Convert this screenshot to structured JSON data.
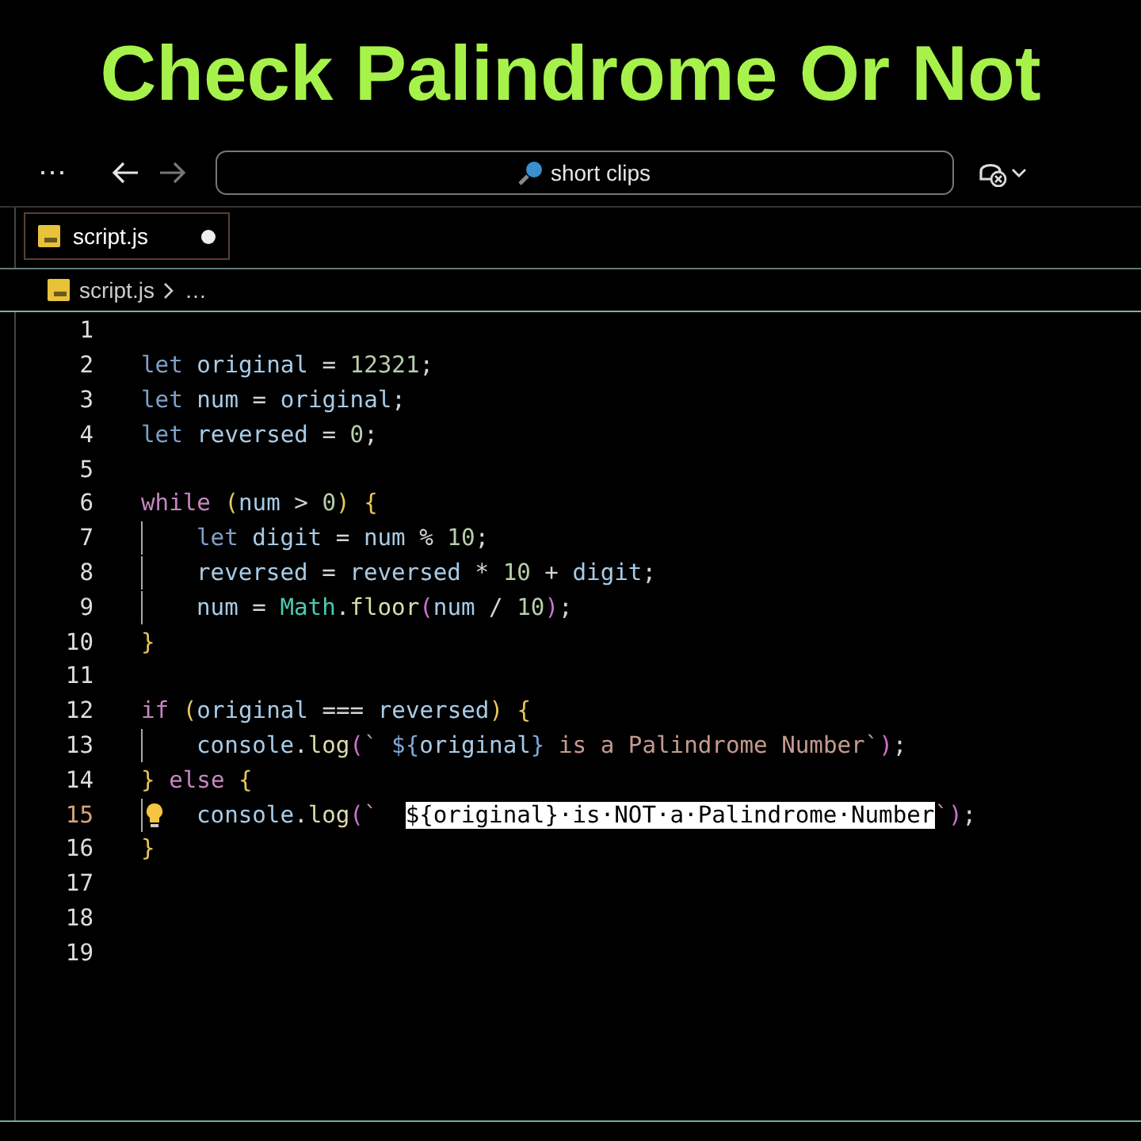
{
  "headline": "Check Palindrome Or Not",
  "toolbar": {
    "more": "⋯",
    "back_enabled": true,
    "forward_enabled": false,
    "search": {
      "value": "short clips"
    }
  },
  "tabs": [
    {
      "label": "script.js",
      "selected": true,
      "modified": true
    }
  ],
  "breadcrumb": [
    "script.js",
    "…"
  ],
  "editor": {
    "lines": [
      {
        "number": "1",
        "current": false
      },
      {
        "number": "2",
        "current": false,
        "tokens": [
          {
            "text": "let",
            "kind": "keyword"
          },
          {
            "text": " original",
            "kind": "variable"
          },
          {
            "text": " = ",
            "kind": "plain"
          },
          {
            "text": "12321",
            "kind": "number"
          },
          {
            "text": ";",
            "kind": "plain"
          }
        ]
      },
      {
        "number": "3",
        "current": false,
        "tokens": [
          {
            "text": "let",
            "kind": "keyword"
          },
          {
            "text": " num",
            "kind": "variable"
          },
          {
            "text": " = ",
            "kind": "plain"
          },
          {
            "text": "original",
            "kind": "variable"
          },
          {
            "text": ";",
            "kind": "plain"
          }
        ]
      },
      {
        "number": "4",
        "current": false,
        "tokens": [
          {
            "text": "let",
            "kind": "keyword"
          },
          {
            "text": " reversed",
            "kind": "variable"
          },
          {
            "text": " = ",
            "kind": "plain"
          },
          {
            "text": "0",
            "kind": "number"
          },
          {
            "text": ";",
            "kind": "plain"
          }
        ]
      },
      {
        "number": "5",
        "current": false
      },
      {
        "number": "6",
        "current": false,
        "tokens": [
          {
            "text": "while",
            "kind": "control"
          },
          {
            "text": " (",
            "kind": "bracket"
          },
          {
            "text": "num",
            "kind": "variable"
          },
          {
            "text": " > ",
            "kind": "plain"
          },
          {
            "text": "0",
            "kind": "number"
          },
          {
            "text": ") {",
            "kind": "bracket"
          }
        ]
      },
      {
        "number": "7",
        "current": false,
        "indent": true,
        "tokens": [
          {
            "text": "let",
            "kind": "keyword"
          },
          {
            "text": " digit",
            "kind": "variable"
          },
          {
            "text": " = ",
            "kind": "plain"
          },
          {
            "text": "num",
            "kind": "variable"
          },
          {
            "text": " % ",
            "kind": "plain"
          },
          {
            "text": "10",
            "kind": "number"
          },
          {
            "text": ";",
            "kind": "plain"
          }
        ]
      },
      {
        "number": "8",
        "current": false,
        "indent": true,
        "tokens": [
          {
            "text": "reversed",
            "kind": "variable"
          },
          {
            "text": " = ",
            "kind": "plain"
          },
          {
            "text": "reversed",
            "kind": "variable"
          },
          {
            "text": " * ",
            "kind": "plain"
          },
          {
            "text": "10",
            "kind": "number"
          },
          {
            "text": " + ",
            "kind": "plain"
          },
          {
            "text": "digit",
            "kind": "variable"
          },
          {
            "text": ";",
            "kind": "plain"
          }
        ]
      },
      {
        "number": "9",
        "current": false,
        "indent": true,
        "tokens": [
          {
            "text": "num",
            "kind": "variable"
          },
          {
            "text": " = ",
            "kind": "plain"
          },
          {
            "text": "Math",
            "kind": "class"
          },
          {
            "text": ".",
            "kind": "plain"
          },
          {
            "text": "floor",
            "kind": "function"
          },
          {
            "text": "(",
            "kind": "bracket2"
          },
          {
            "text": "num",
            "kind": "variable"
          },
          {
            "text": " / ",
            "kind": "plain"
          },
          {
            "text": "10",
            "kind": "number"
          },
          {
            "text": ")",
            "kind": "bracket2"
          },
          {
            "text": ";",
            "kind": "plain"
          }
        ]
      },
      {
        "number": "10",
        "current": false,
        "tokens": [
          {
            "text": "}",
            "kind": "bracket"
          }
        ]
      },
      {
        "number": "11",
        "current": false
      },
      {
        "number": "12",
        "current": false,
        "tokens": [
          {
            "text": "if",
            "kind": "control"
          },
          {
            "text": " (",
            "kind": "bracket"
          },
          {
            "text": "original",
            "kind": "variable"
          },
          {
            "text": " === ",
            "kind": "plain"
          },
          {
            "text": "reversed",
            "kind": "variable"
          },
          {
            "text": ") {",
            "kind": "bracket"
          }
        ]
      },
      {
        "number": "13",
        "current": false,
        "indent": true,
        "tokens": [
          {
            "text": "console",
            "kind": "variable"
          },
          {
            "text": ".",
            "kind": "plain"
          },
          {
            "text": "log",
            "kind": "function"
          },
          {
            "text": "(",
            "kind": "bracket2"
          },
          {
            "text": "` ",
            "kind": "string"
          },
          {
            "text": "${",
            "kind": "interp"
          },
          {
            "text": "original",
            "kind": "variable"
          },
          {
            "text": "}",
            "kind": "interp"
          },
          {
            "text": " is a Palindrome Number`",
            "kind": "string"
          },
          {
            "text": ")",
            "kind": "bracket2"
          },
          {
            "text": ";",
            "kind": "plain"
          }
        ]
      },
      {
        "number": "14",
        "current": false,
        "tokens": [
          {
            "text": "}",
            "kind": "bracket"
          },
          {
            "text": " else",
            "kind": "control"
          },
          {
            "text": " {",
            "kind": "bracket"
          }
        ]
      },
      {
        "number": "15",
        "current": true,
        "indent": true,
        "lightbulb": true,
        "tokens": [
          {
            "text": "console",
            "kind": "variable"
          },
          {
            "text": ".",
            "kind": "plain"
          },
          {
            "text": "log",
            "kind": "function"
          },
          {
            "text": "(",
            "kind": "bracket2"
          },
          {
            "text": "`  ",
            "kind": "string"
          },
          {
            "text": "${original}·is·NOT·a·Palindrome·Number",
            "kind": "selection"
          },
          {
            "text": "`",
            "kind": "string"
          },
          {
            "text": ")",
            "kind": "bracket2"
          },
          {
            "text": ";",
            "kind": "plain"
          }
        ]
      },
      {
        "number": "16",
        "current": false,
        "tokens": [
          {
            "text": "}",
            "kind": "bracket"
          }
        ]
      },
      {
        "number": "17",
        "current": false
      },
      {
        "number": "18",
        "current": false
      },
      {
        "number": "19",
        "current": false
      }
    ]
  }
}
